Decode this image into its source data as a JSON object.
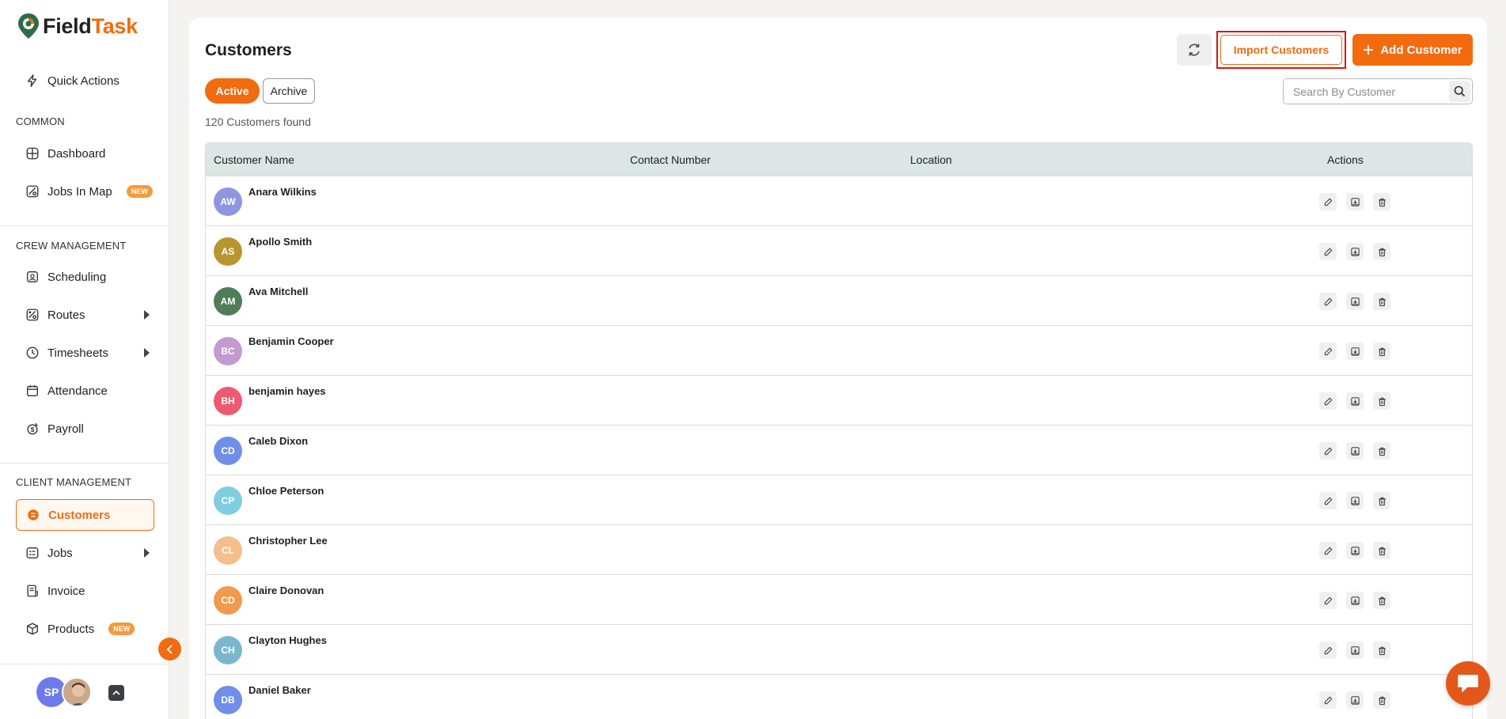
{
  "app": {
    "logo_field": "Field",
    "logo_task": "Task"
  },
  "sidebar": {
    "quick_actions": "Quick Actions",
    "sections": {
      "common": "COMMON",
      "crew": "CREW MANAGEMENT",
      "client": "CLIENT MANAGEMENT"
    },
    "items": [
      {
        "label": "Dashboard"
      },
      {
        "label": "Jobs In Map",
        "badge": "NEW"
      },
      {
        "label": "Scheduling"
      },
      {
        "label": "Routes"
      },
      {
        "label": "Timesheets"
      },
      {
        "label": "Attendance"
      },
      {
        "label": "Payroll"
      },
      {
        "label": "Customers"
      },
      {
        "label": "Jobs"
      },
      {
        "label": "Invoice"
      },
      {
        "label": "Products",
        "badge": "NEW"
      }
    ],
    "user_initials": "SP"
  },
  "header": {
    "title": "Customers",
    "import_label": "Import Customers",
    "add_label": "Add Customer"
  },
  "filters": {
    "active_label": "Active",
    "archive_label": "Archive",
    "search_placeholder": "Search By Customer"
  },
  "count_text": "120 Customers found",
  "table": {
    "columns": [
      "Customer Name",
      "Contact Number",
      "Location",
      "Actions"
    ],
    "rows": [
      {
        "initials": "AW",
        "name": "Anara Wilkins",
        "color": "#8e96e0"
      },
      {
        "initials": "AS",
        "name": "Apollo Smith",
        "color": "#b8952e"
      },
      {
        "initials": "AM",
        "name": "Ava Mitchell",
        "color": "#4e7d58"
      },
      {
        "initials": "BC",
        "name": "Benjamin Cooper",
        "color": "#c49ad0"
      },
      {
        "initials": "BH",
        "name": "benjamin hayes",
        "color": "#ee5b6e"
      },
      {
        "initials": "CD",
        "name": "Caleb Dixon",
        "color": "#6f8fe8"
      },
      {
        "initials": "CP",
        "name": "Chloe Peterson",
        "color": "#7fcde0"
      },
      {
        "initials": "CL",
        "name": "Christopher Lee",
        "color": "#f5be8a"
      },
      {
        "initials": "CD",
        "name": "Claire Donovan",
        "color": "#f29a4c"
      },
      {
        "initials": "CH",
        "name": "Clayton Hughes",
        "color": "#7ab7cf"
      },
      {
        "initials": "DB",
        "name": "Daniel Baker",
        "color": "#6f8fe8"
      }
    ]
  },
  "colors": {
    "accent": "#f26b0f",
    "header_bg": "#dbe6e5",
    "highlight_border": "#d21818"
  }
}
